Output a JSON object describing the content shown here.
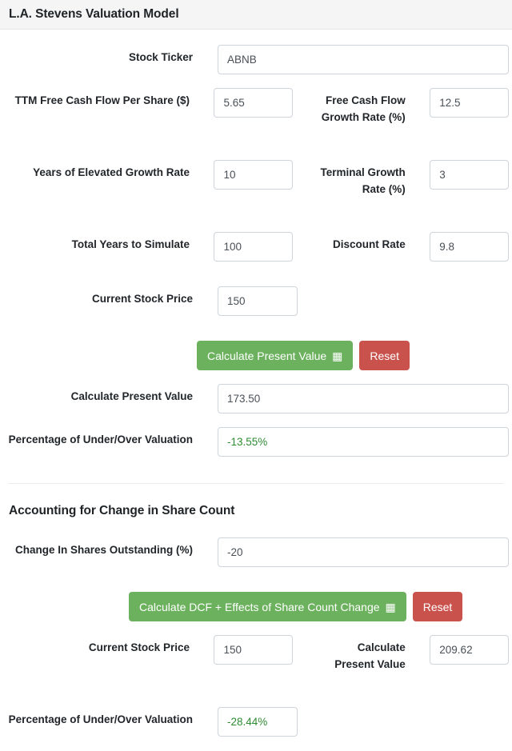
{
  "card": {
    "title": "L.A. Stevens Valuation Model"
  },
  "section_primary": {
    "rows": [
      {
        "left_label": "Stock Ticker",
        "left_value": "ABNB",
        "left_placeholder": "",
        "right_label": "",
        "right_value": ""
      },
      {
        "left_label": "TTM Free Cash Flow Per Share ($)",
        "left_value": "5.65",
        "right_label": "Free Cash Flow Growth Rate (%)",
        "right_value": "12.5"
      },
      {
        "left_label": "Years of Elevated Growth Rate",
        "left_value": "10",
        "right_label": "Terminal Growth Rate (%)",
        "right_value": "3"
      },
      {
        "left_label": "Total Years to Simulate",
        "left_value": "100",
        "right_label": "Discount Rate",
        "right_value": "9.8"
      },
      {
        "left_label": "Current Stock Price",
        "left_value": "150",
        "right_label": "",
        "right_value": ""
      }
    ],
    "buttons": {
      "calculate_label": "Calculate Present Value",
      "calculate_icon": "abacus-icon",
      "calculate_glyph": "▦",
      "reset_label": "Reset"
    },
    "results": [
      {
        "label": "Calculate Present Value",
        "value": "173.50",
        "is_green": false
      },
      {
        "label": "Percentage of Under/Over Valuation",
        "value": "-13.55%",
        "is_green": true
      }
    ]
  },
  "section_share_count": {
    "title": "Accounting for Change in Share Count",
    "input_row": {
      "label": "Change In Shares Outstanding (%)",
      "value": "-20"
    },
    "buttons": {
      "calculate_label": "Calculate DCF + Effects of Share Count Change",
      "calculate_icon": "abacus-icon",
      "calculate_glyph": "▦",
      "reset_label": "Reset"
    },
    "rows": [
      {
        "left_label": "Current Stock Price",
        "left_value": "150",
        "right_label": "Calculate Present Value",
        "right_value": "209.62"
      },
      {
        "left_label": "Percentage of Under/Over Valuation",
        "left_value": "-28.44%",
        "left_green": true,
        "right_label": "",
        "right_value": ""
      }
    ]
  },
  "colors": {
    "green_button": "#6cb25e",
    "red_button": "#c9524d",
    "green_text": "#2f8b33",
    "header_bg": "#f5f5f5",
    "input_border": "#ced4da",
    "label_text": "#22262a"
  }
}
